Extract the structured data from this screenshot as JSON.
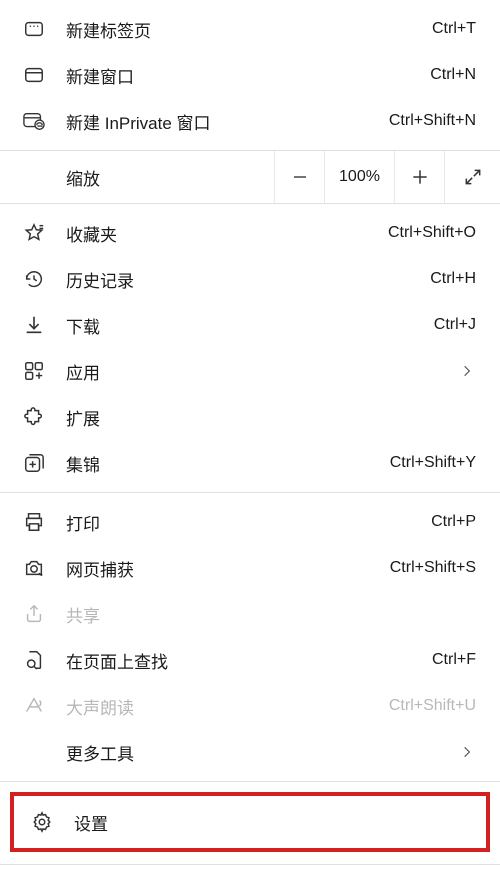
{
  "group1": {
    "newTab": {
      "label": "新建标签页",
      "shortcut": "Ctrl+T"
    },
    "newWin": {
      "label": "新建窗口",
      "shortcut": "Ctrl+N"
    },
    "newPriv": {
      "label": "新建 InPrivate 窗口",
      "shortcut": "Ctrl+Shift+N"
    }
  },
  "zoom": {
    "label": "缩放",
    "value": "100%"
  },
  "group2": {
    "favorites": {
      "label": "收藏夹",
      "shortcut": "Ctrl+Shift+O"
    },
    "history": {
      "label": "历史记录",
      "shortcut": "Ctrl+H"
    },
    "downloads": {
      "label": "下载",
      "shortcut": "Ctrl+J"
    },
    "apps": {
      "label": "应用"
    },
    "extensions": {
      "label": "扩展"
    },
    "collections": {
      "label": "集锦",
      "shortcut": "Ctrl+Shift+Y"
    }
  },
  "group3": {
    "print": {
      "label": "打印",
      "shortcut": "Ctrl+P"
    },
    "capture": {
      "label": "网页捕获",
      "shortcut": "Ctrl+Shift+S"
    },
    "share": {
      "label": "共享"
    },
    "find": {
      "label": "在页面上查找",
      "shortcut": "Ctrl+F"
    },
    "read": {
      "label": "大声朗读",
      "shortcut": "Ctrl+Shift+U"
    },
    "more": {
      "label": "更多工具"
    }
  },
  "group4": {
    "settings": {
      "label": "设置"
    }
  }
}
